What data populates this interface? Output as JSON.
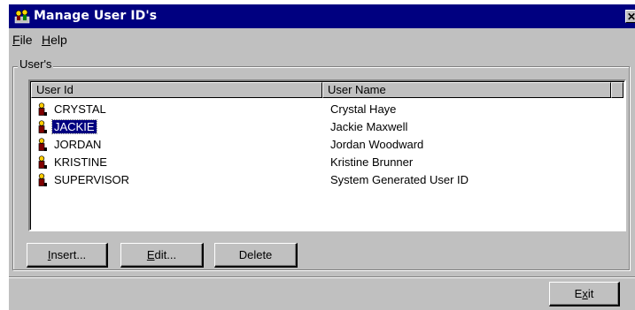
{
  "window": {
    "title": "Manage User ID's",
    "close_label": "✕"
  },
  "menu": {
    "file_label": "F",
    "file_rest": "ile",
    "help_label": "H",
    "help_rest": "elp"
  },
  "group": {
    "label": "User's"
  },
  "table": {
    "columns": [
      "User Id",
      "User Name"
    ],
    "rows": [
      {
        "user_id": "CRYSTAL",
        "user_name": "Crystal Haye",
        "selected": false
      },
      {
        "user_id": "JACKIE",
        "user_name": "Jackie Maxwell",
        "selected": true
      },
      {
        "user_id": "JORDAN",
        "user_name": "Jordan Woodward",
        "selected": false
      },
      {
        "user_id": "KRISTINE",
        "user_name": "Kristine Brunner",
        "selected": false
      },
      {
        "user_id": "SUPERVISOR",
        "user_name": "System Generated User ID",
        "selected": false
      }
    ]
  },
  "buttons": {
    "insert_ul": "I",
    "insert_rest": "nsert...",
    "edit_ul": "E",
    "edit_rest": "dit...",
    "delete_label": "Delete",
    "exit_pre": "E",
    "exit_ul": "x",
    "exit_rest": "it"
  },
  "colors": {
    "titlebar": "#000080",
    "face": "#c0c0c0",
    "selection": "#000080"
  },
  "icons": {
    "title": "users-app-icon",
    "row": "user-icon"
  }
}
